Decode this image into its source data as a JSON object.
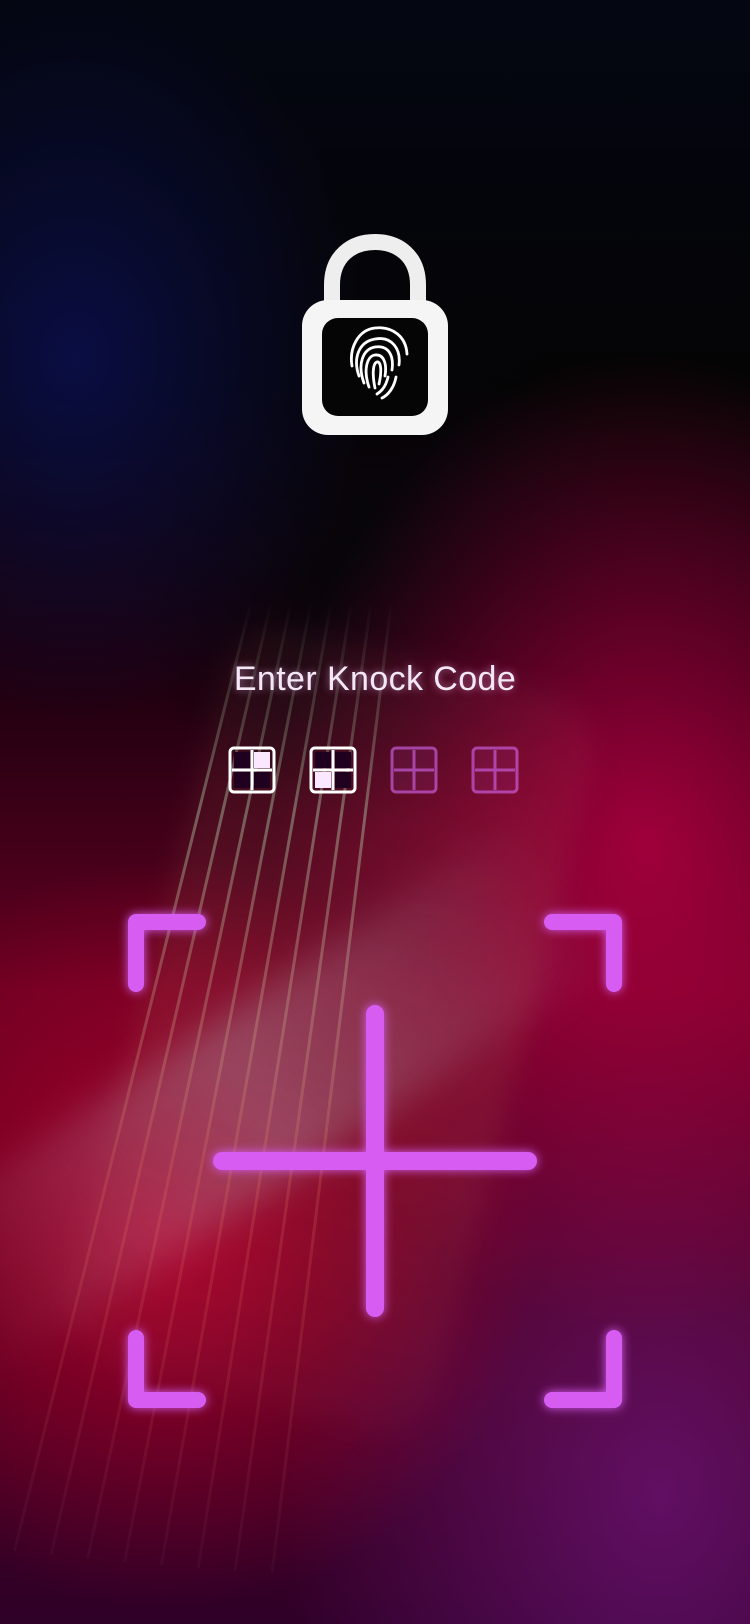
{
  "screen": {
    "title": "Enter Knock Code",
    "icons": {
      "lock": "fingerprint-padlock-icon",
      "knock_pad": "knock-code-pad"
    },
    "code": {
      "entered_count": 2,
      "total_count": 4,
      "indicators": [
        {
          "state": "entered",
          "highlighted_quadrant": "top-right"
        },
        {
          "state": "entered",
          "highlighted_quadrant": "bottom-left"
        },
        {
          "state": "empty",
          "highlighted_quadrant": ""
        },
        {
          "state": "empty",
          "highlighted_quadrant": ""
        }
      ]
    },
    "colors": {
      "accent": "#d65cf2",
      "title_text": "#f4e8f7",
      "lock_body": "#f2f2f2",
      "lock_inner": "#060606"
    }
  }
}
